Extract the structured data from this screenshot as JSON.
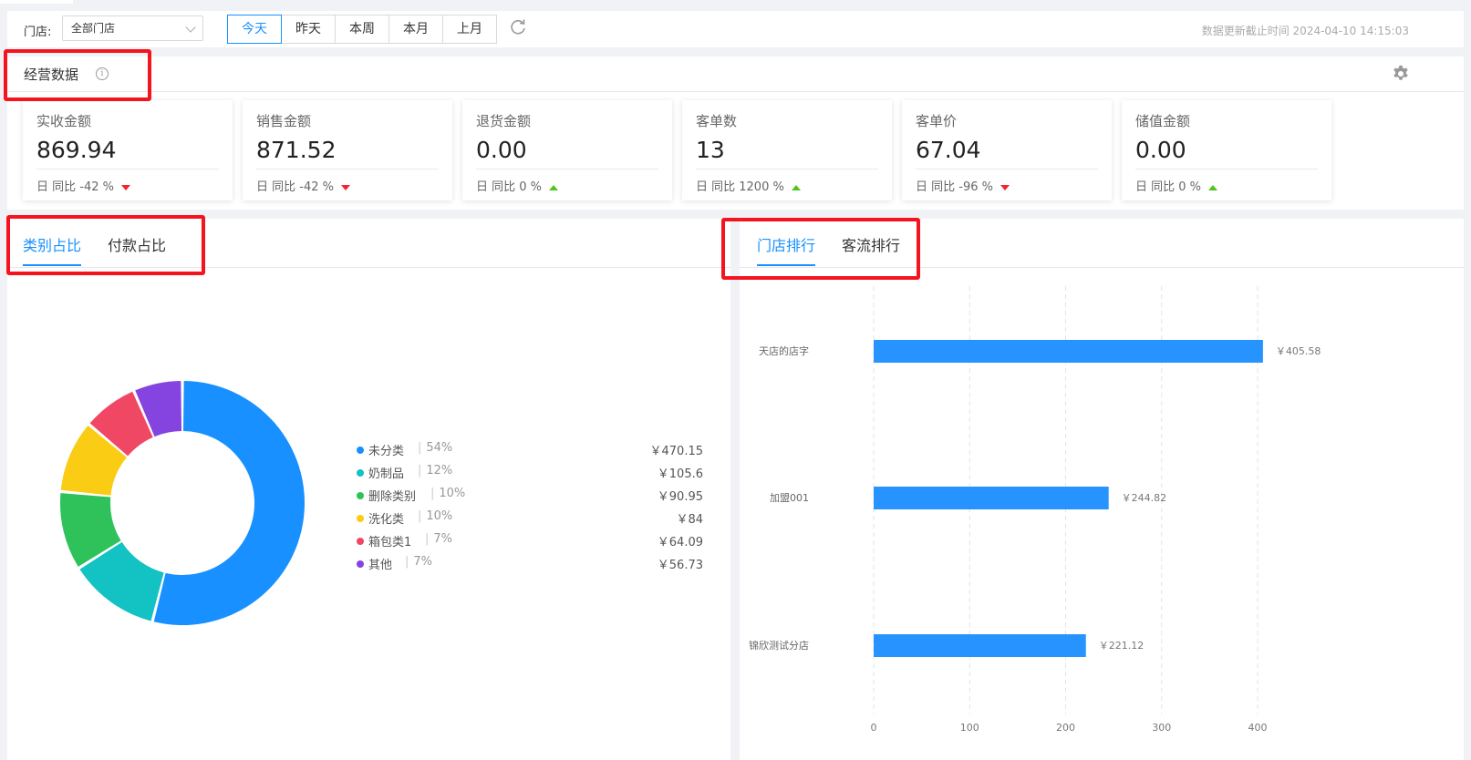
{
  "topbar": {
    "store_label": "门店:",
    "store_value": "全部门店",
    "ranges": [
      "今天",
      "昨天",
      "本周",
      "本月",
      "上月"
    ],
    "active_range": 0,
    "update_time": "数据更新截止时间 2024-04-10 14:15:03"
  },
  "ops": {
    "title": "经营数据",
    "info_glyph": "i",
    "cards": [
      {
        "label": "实收金额",
        "value": "869.94",
        "compare": "日 同比 -42 %",
        "trend": "down"
      },
      {
        "label": "销售金额",
        "value": "871.52",
        "compare": "日 同比 -42 %",
        "trend": "down"
      },
      {
        "label": "退货金额",
        "value": "0.00",
        "compare": "日 同比 0 %",
        "trend": "up"
      },
      {
        "label": "客单数",
        "value": "13",
        "compare": "日 同比 1200 %",
        "trend": "up"
      },
      {
        "label": "客单价",
        "value": "67.04",
        "compare": "日 同比 -96 %",
        "trend": "down"
      },
      {
        "label": "储值金额",
        "value": "0.00",
        "compare": "日 同比 0 %",
        "trend": "up"
      }
    ]
  },
  "left_panel": {
    "tabs": [
      "类别占比",
      "付款占比"
    ],
    "active_tab": 0
  },
  "right_panel": {
    "tabs": [
      "门店排行",
      "客流排行"
    ],
    "active_tab": 0
  },
  "colors": {
    "accent": "#1890ff",
    "down": "#f5222d",
    "up": "#52c41a",
    "highlight_box": "#f5141e"
  },
  "chart_data": [
    {
      "type": "pie",
      "categories": [
        "未分类",
        "奶制品",
        "删除类别",
        "洗化类",
        "箱包类1",
        "其他"
      ],
      "percent_labels": [
        "54%",
        "12%",
        "10%",
        "10%",
        "7%",
        "7%"
      ],
      "amount_labels": [
        "￥470.15",
        "￥105.6",
        "￥90.95",
        "￥84",
        "￥64.09",
        "￥56.73"
      ],
      "values": [
        470.15,
        105.6,
        90.95,
        84,
        64.09,
        56.73
      ],
      "colors": [
        "#1890ff",
        "#13c2c2",
        "#2fc25b",
        "#facc14",
        "#f04864",
        "#8543e0"
      ],
      "legend_position": "right"
    },
    {
      "type": "bar",
      "orientation": "horizontal",
      "categories": [
        "天店的店字",
        "加盟001",
        "锦欣测试分店"
      ],
      "values": [
        405.58,
        244.82,
        221.12
      ],
      "value_labels": [
        "￥405.58",
        "￥244.82",
        "￥221.12"
      ],
      "xticks": [
        "0",
        "100",
        "200",
        "300",
        "400"
      ],
      "xlim": [
        0,
        400
      ],
      "grid": true,
      "color": "#2693ff"
    }
  ]
}
